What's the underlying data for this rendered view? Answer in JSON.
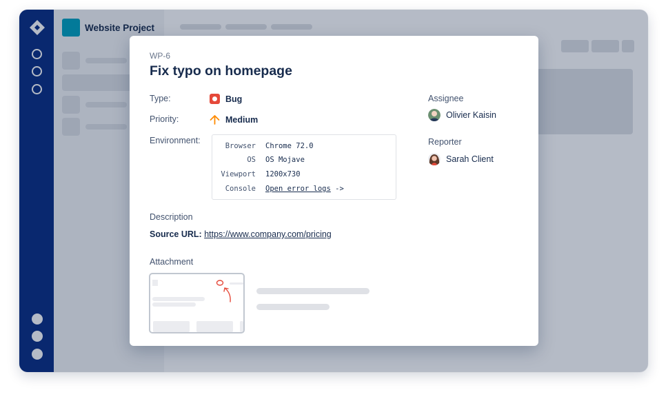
{
  "sidebar": {
    "project_name": "Website Project"
  },
  "issue": {
    "key": "WP-6",
    "title": "Fix typo on homepage",
    "type_label": "Type:",
    "type_value": "Bug",
    "priority_label": "Priority:",
    "priority_value": "Medium",
    "environment_label": "Environment:",
    "environment": [
      {
        "key": "Browser",
        "value": "Chrome 72.0"
      },
      {
        "key": "OS",
        "value": "OS Mojave"
      },
      {
        "key": "Viewport",
        "value": "1200x730"
      },
      {
        "key": "Console",
        "value": "Open error logs",
        "suffix": " ->"
      }
    ],
    "description_label": "Description",
    "source_label": "Source URL:",
    "source_url": "https://www.company.com/pricing",
    "attachment_label": "Attachment",
    "assignee_label": "Assignee",
    "assignee_name": "Olivier Kaisin",
    "reporter_label": "Reporter",
    "reporter_name": "Sarah Client"
  },
  "icons": {
    "logo": "diamond-logo-icon",
    "type": "bug-icon",
    "priority": "arrow-up-icon"
  },
  "colors": {
    "nav": "#0a2d83",
    "project_avatar": "#00a3bf",
    "bug": "#e5493a",
    "priority_medium": "#ff8b00",
    "annotation": "#e5493a"
  }
}
